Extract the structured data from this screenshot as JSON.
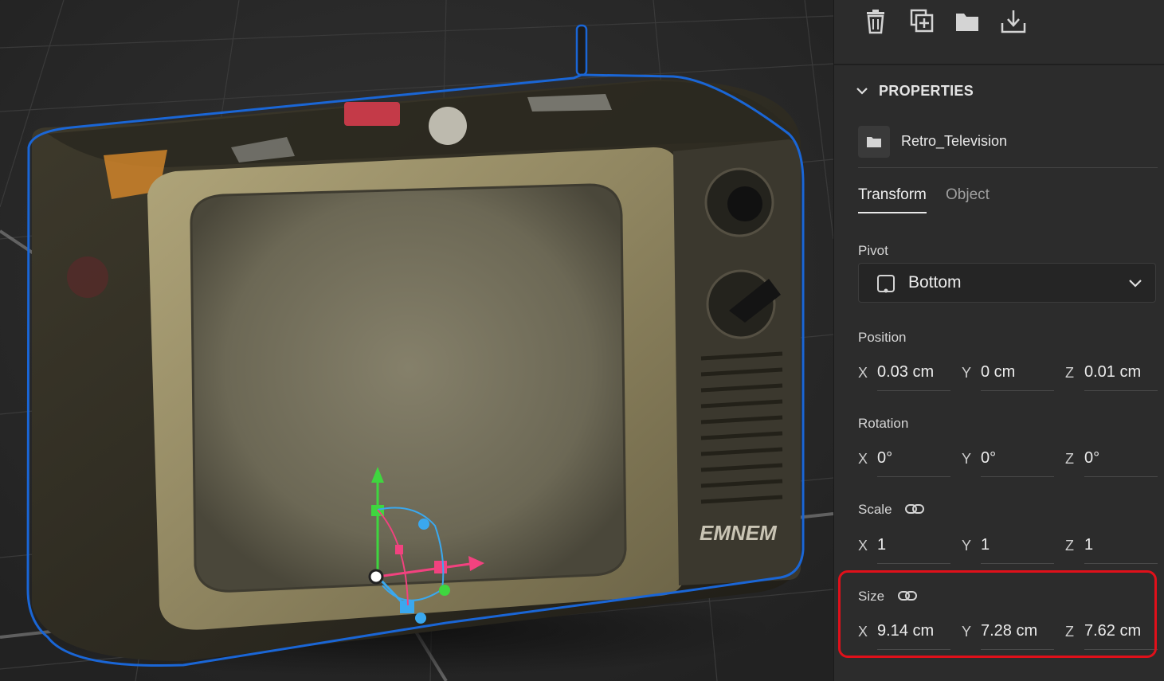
{
  "toolbar": {
    "icons": [
      "trash-icon",
      "duplicate-icon",
      "folder-icon",
      "export-icon"
    ]
  },
  "properties": {
    "header": "PROPERTIES",
    "object_name": "Retro_Television",
    "tabs": [
      {
        "label": "Transform",
        "active": true
      },
      {
        "label": "Object",
        "active": false
      }
    ],
    "pivot": {
      "label": "Pivot",
      "value": "Bottom"
    },
    "position": {
      "label": "Position",
      "x": "0.03 cm",
      "y": "0 cm",
      "z": "0.01 cm"
    },
    "rotation": {
      "label": "Rotation",
      "x": "0°",
      "y": "0°",
      "z": "0°"
    },
    "scale": {
      "label": "Scale",
      "x": "1",
      "y": "1",
      "z": "1"
    },
    "size": {
      "label": "Size",
      "x": "9.14 cm",
      "y": "7.28 cm",
      "z": "7.62 cm"
    },
    "axis_labels": {
      "x": "X",
      "y": "Y",
      "z": "Z"
    }
  },
  "viewport": {
    "logo_text": "EMNEM"
  },
  "colors": {
    "selection_outline": "#1a66d6",
    "highlight_box": "#e0101a",
    "panel_bg": "#2c2c2c"
  }
}
